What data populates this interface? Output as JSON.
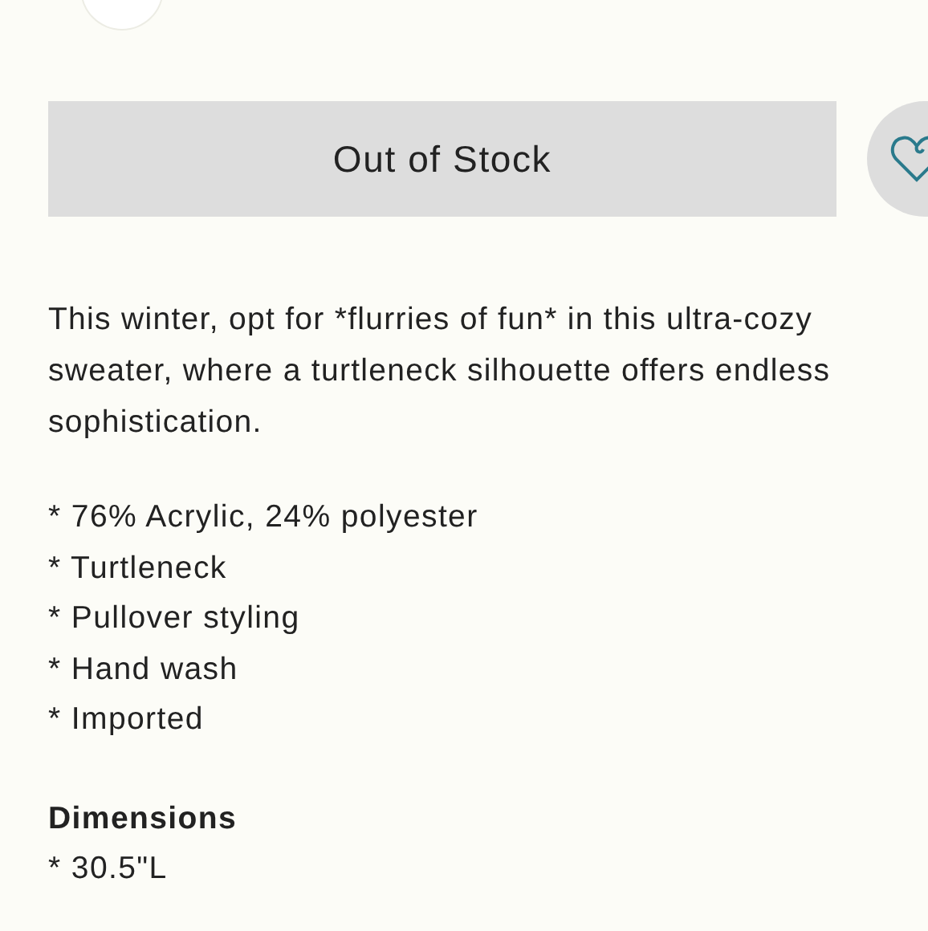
{
  "stock_button": {
    "label": "Out of Stock",
    "disabled": true
  },
  "favorite_button": {
    "selected": false
  },
  "description": "This winter, opt for *flurries of fun* in this ultra-cozy sweater, where a turtleneck silhouette offers endless sophistication.",
  "features": [
    "* 76% Acrylic, 24% polyester",
    "* Turtleneck",
    "* Pullover styling",
    "* Hand wash",
    "* Imported"
  ],
  "dimensions": {
    "heading": "Dimensions",
    "items": [
      "* 30.5\"L"
    ]
  }
}
